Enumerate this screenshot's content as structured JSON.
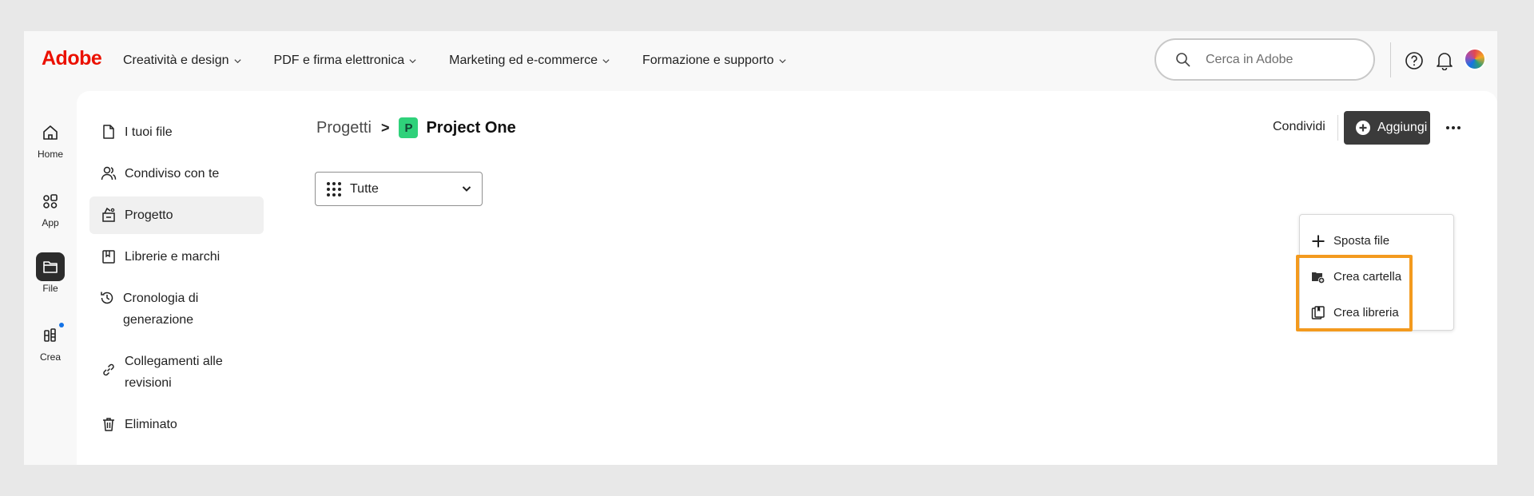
{
  "brand": {
    "logo": "Adobe",
    "color": "#eb1000"
  },
  "nav": {
    "items": [
      {
        "label": "Creatività e design"
      },
      {
        "label": "PDF e firma elettronica"
      },
      {
        "label": "Marketing ed e-commerce"
      },
      {
        "label": "Formazione e supporto"
      }
    ],
    "search_placeholder": "Cerca in Adobe",
    "icons": [
      "search-icon",
      "help-icon",
      "bell-icon",
      "avatar"
    ]
  },
  "rail": {
    "items": [
      {
        "label": "Home",
        "icon": "home-icon"
      },
      {
        "label": "App",
        "icon": "apps-icon"
      },
      {
        "label": "File",
        "icon": "folder-icon",
        "active": true
      },
      {
        "label": "Crea",
        "icon": "create-icon",
        "badge": true
      }
    ]
  },
  "sidebar": {
    "items": [
      {
        "label": "I tuoi file",
        "icon": "file-icon"
      },
      {
        "label": "Condiviso con te",
        "icon": "people-icon"
      },
      {
        "label": "Progetto",
        "icon": "project-icon",
        "active": true
      },
      {
        "label": "Librerie e marchi",
        "icon": "library-icon"
      },
      {
        "label": "Cronologia di generazione",
        "icon": "history-icon"
      },
      {
        "label_line1": "Collegamenti alle",
        "label_line2": "revisioni",
        "icon": "link-icon"
      },
      {
        "label": "Eliminato",
        "icon": "trash-icon"
      }
    ]
  },
  "breadcrumb": {
    "parent": "Progetti",
    "separator": ">",
    "badge": "P",
    "current": "Project One",
    "badge_color": "#2fd17a"
  },
  "filter": {
    "selected": "Tutte"
  },
  "actions": {
    "share": "Condividi",
    "add": "Aggiungi",
    "more": "···"
  },
  "dropdown": {
    "items": [
      {
        "label": "Sposta file",
        "icon": "plus-icon"
      },
      {
        "label": "Crea cartella",
        "icon": "folder-add-icon"
      },
      {
        "label": "Crea libreria",
        "icon": "library-add-icon"
      }
    ],
    "highlight_color": "#f39a1e"
  }
}
